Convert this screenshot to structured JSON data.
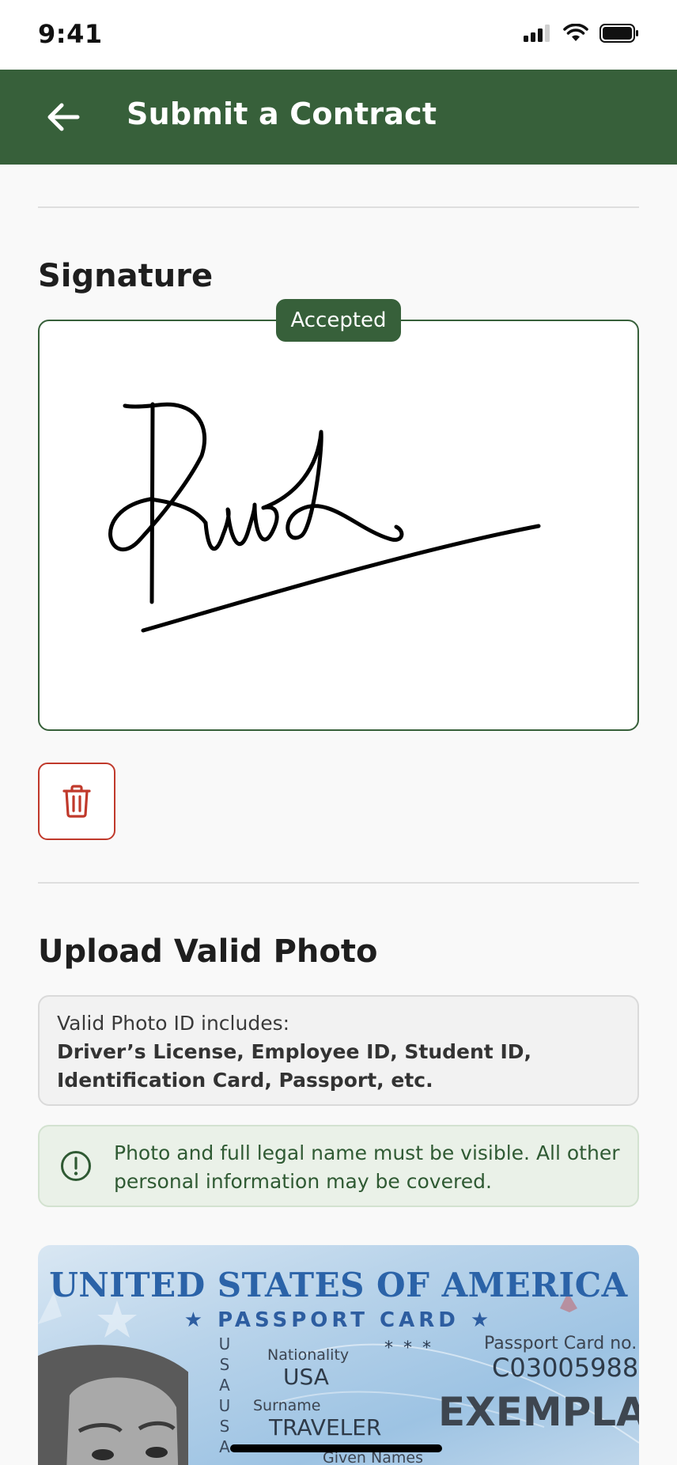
{
  "status_bar": {
    "time": "9:41",
    "icons": [
      "cellular-signal-icon",
      "wifi-icon",
      "battery-icon"
    ]
  },
  "app_bar": {
    "title": "Submit a Contract",
    "back_icon": "arrow-left-icon"
  },
  "signature": {
    "heading": "Signature",
    "status_badge": "Accepted",
    "delete_icon": "trash-icon"
  },
  "upload": {
    "heading": "Upload Valid Photo",
    "id_info_label": "Valid Photo ID includes:",
    "id_types": "Driver’s License, Employee ID, Student ID, Identification Card, Passport, etc.",
    "notice_icon": "exclamation-circle-icon",
    "notice_text": "Photo and full legal name must be visible. All other personal information may be covered."
  },
  "id_card": {
    "country": "UNITED STATES OF AMERICA",
    "type": "★ PASSPORT CARD ★",
    "vertical_text": "USAUSA",
    "nationality_label": "Nationality",
    "nationality": "USA",
    "stars": "* * *",
    "card_no_label": "Passport Card no.",
    "card_no": "C03005988",
    "surname_label": "Surname",
    "surname": "TRAVELER",
    "given_names_label": "Given Names",
    "watermark": "EXEMPLAR"
  },
  "colors": {
    "primary": "#37603a",
    "danger": "#c0392b",
    "notice_bg": "#eaf1e8"
  }
}
